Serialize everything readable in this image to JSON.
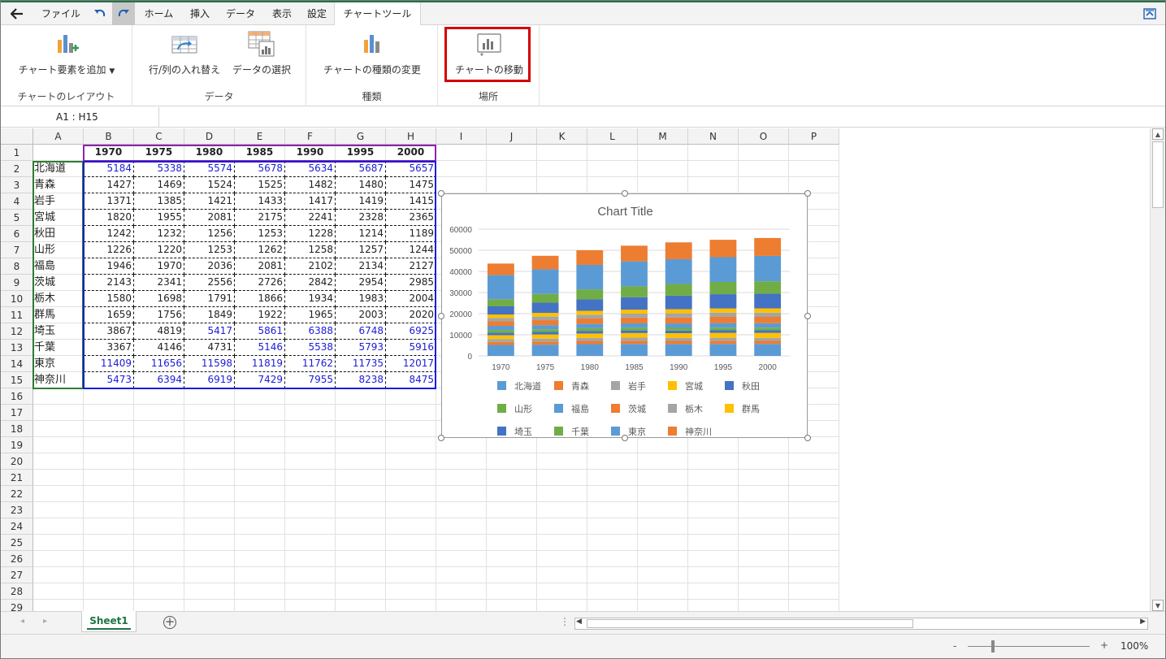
{
  "menubar": {
    "file_label": "ファイル",
    "tabs": [
      "ホーム",
      "挿入",
      "データ",
      "表示",
      "設定",
      "チャートツール"
    ],
    "active_tab": "チャートツール"
  },
  "ribbon": {
    "groups": [
      {
        "label": "チャートのレイアウト",
        "buttons": [
          "チャート要素を追加"
        ]
      },
      {
        "label": "データ",
        "buttons": [
          "行/列の入れ替え",
          "データの選択"
        ]
      },
      {
        "label": "種類",
        "buttons": [
          "チャートの種類の変更"
        ]
      },
      {
        "label": "場所",
        "buttons": [
          "チャートの移動"
        ]
      }
    ],
    "highlighted_button": "チャートの移動",
    "highlight_color": "#d40000"
  },
  "namebox": {
    "value": "A1 : H15"
  },
  "columns": [
    "A",
    "B",
    "C",
    "D",
    "E",
    "F",
    "G",
    "H",
    "I",
    "J",
    "K",
    "L",
    "M",
    "N",
    "O",
    "P"
  ],
  "row_count": 29,
  "table": {
    "years": [
      "1970",
      "1975",
      "1980",
      "1985",
      "1990",
      "1995",
      "2000"
    ],
    "rows": [
      {
        "pref": "北海道",
        "values": [
          "5184",
          "5338",
          "5574",
          "5678",
          "5634",
          "5687",
          "5657"
        ],
        "blue": [
          true,
          true,
          true,
          true,
          true,
          true,
          true
        ]
      },
      {
        "pref": "青森",
        "values": [
          "1427",
          "1469",
          "1524",
          "1525",
          "1482",
          "1480",
          "1475"
        ],
        "blue": [
          false,
          false,
          false,
          false,
          false,
          false,
          false
        ]
      },
      {
        "pref": "岩手",
        "values": [
          "1371",
          "1385",
          "1421",
          "1433",
          "1417",
          "1419",
          "1415"
        ],
        "blue": [
          false,
          false,
          false,
          false,
          false,
          false,
          false
        ]
      },
      {
        "pref": "宮城",
        "values": [
          "1820",
          "1955",
          "2081",
          "2175",
          "2241",
          "2328",
          "2365"
        ],
        "blue": [
          false,
          false,
          false,
          false,
          false,
          false,
          false
        ]
      },
      {
        "pref": "秋田",
        "values": [
          "1242",
          "1232",
          "1256",
          "1253",
          "1228",
          "1214",
          "1189"
        ],
        "blue": [
          false,
          false,
          false,
          false,
          false,
          false,
          false
        ]
      },
      {
        "pref": "山形",
        "values": [
          "1226",
          "1220",
          "1253",
          "1262",
          "1258",
          "1257",
          "1244"
        ],
        "blue": [
          false,
          false,
          false,
          false,
          false,
          false,
          false
        ]
      },
      {
        "pref": "福島",
        "values": [
          "1946",
          "1970",
          "2036",
          "2081",
          "2102",
          "2134",
          "2127"
        ],
        "blue": [
          false,
          false,
          false,
          false,
          false,
          false,
          false
        ]
      },
      {
        "pref": "茨城",
        "values": [
          "2143",
          "2341",
          "2556",
          "2726",
          "2842",
          "2954",
          "2985"
        ],
        "blue": [
          false,
          false,
          false,
          false,
          false,
          false,
          false
        ]
      },
      {
        "pref": "栃木",
        "values": [
          "1580",
          "1698",
          "1791",
          "1866",
          "1934",
          "1983",
          "2004"
        ],
        "blue": [
          false,
          false,
          false,
          false,
          false,
          false,
          false
        ]
      },
      {
        "pref": "群馬",
        "values": [
          "1659",
          "1756",
          "1849",
          "1922",
          "1965",
          "2003",
          "2020"
        ],
        "blue": [
          false,
          false,
          false,
          false,
          false,
          false,
          false
        ]
      },
      {
        "pref": "埼玉",
        "values": [
          "3867",
          "4819",
          "5417",
          "5861",
          "6388",
          "6748",
          "6925"
        ],
        "blue": [
          false,
          false,
          true,
          true,
          true,
          true,
          true
        ]
      },
      {
        "pref": "千葉",
        "values": [
          "3367",
          "4146",
          "4731",
          "5146",
          "5538",
          "5793",
          "5916"
        ],
        "blue": [
          false,
          false,
          false,
          true,
          true,
          true,
          true
        ]
      },
      {
        "pref": "東京",
        "values": [
          "11409",
          "11656",
          "11598",
          "11819",
          "11762",
          "11735",
          "12017"
        ],
        "blue": [
          true,
          true,
          true,
          true,
          true,
          true,
          true
        ]
      },
      {
        "pref": "神奈川",
        "values": [
          "5473",
          "6394",
          "6919",
          "7429",
          "7955",
          "8238",
          "8475"
        ],
        "blue": [
          true,
          true,
          true,
          true,
          true,
          true,
          true
        ]
      }
    ]
  },
  "chart_data": {
    "type": "bar",
    "stacked": true,
    "title": "Chart Title",
    "categories": [
      "1970",
      "1975",
      "1980",
      "1985",
      "1990",
      "1995",
      "2000"
    ],
    "ylim": [
      0,
      60000
    ],
    "yticks": [
      "0",
      "10000",
      "20000",
      "30000",
      "40000",
      "50000",
      "60000"
    ],
    "legend_position": "bottom",
    "series": [
      {
        "name": "北海道",
        "color": "#5b9bd5",
        "values": [
          5184,
          5338,
          5574,
          5678,
          5634,
          5687,
          5657
        ]
      },
      {
        "name": "青森",
        "color": "#ed7d31",
        "values": [
          1427,
          1469,
          1524,
          1525,
          1482,
          1480,
          1475
        ]
      },
      {
        "name": "岩手",
        "color": "#a5a5a5",
        "values": [
          1371,
          1385,
          1421,
          1433,
          1417,
          1419,
          1415
        ]
      },
      {
        "name": "宮城",
        "color": "#ffc000",
        "values": [
          1820,
          1955,
          2081,
          2175,
          2241,
          2328,
          2365
        ]
      },
      {
        "name": "秋田",
        "color": "#4472c4",
        "values": [
          1242,
          1232,
          1256,
          1253,
          1228,
          1214,
          1189
        ]
      },
      {
        "name": "山形",
        "color": "#70ad47",
        "values": [
          1226,
          1220,
          1253,
          1262,
          1258,
          1257,
          1244
        ]
      },
      {
        "name": "福島",
        "color": "#5b9bd5",
        "values": [
          1946,
          1970,
          2036,
          2081,
          2102,
          2134,
          2127
        ]
      },
      {
        "name": "茨城",
        "color": "#ed7d31",
        "values": [
          2143,
          2341,
          2556,
          2726,
          2842,
          2954,
          2985
        ]
      },
      {
        "name": "栃木",
        "color": "#a5a5a5",
        "values": [
          1580,
          1698,
          1791,
          1866,
          1934,
          1983,
          2004
        ]
      },
      {
        "name": "群馬",
        "color": "#ffc000",
        "values": [
          1659,
          1756,
          1849,
          1922,
          1965,
          2003,
          2020
        ]
      },
      {
        "name": "埼玉",
        "color": "#4472c4",
        "values": [
          3867,
          4819,
          5417,
          5861,
          6388,
          6748,
          6925
        ]
      },
      {
        "name": "千葉",
        "color": "#70ad47",
        "values": [
          3367,
          4146,
          4731,
          5146,
          5538,
          5793,
          5916
        ]
      },
      {
        "name": "東京",
        "color": "#5b9bd5",
        "values": [
          11409,
          11656,
          11598,
          11819,
          11762,
          11735,
          12017
        ]
      },
      {
        "name": "神奈川",
        "color": "#ed7d31",
        "values": [
          5473,
          6394,
          6919,
          7429,
          7955,
          8238,
          8475
        ]
      }
    ]
  },
  "sheet": {
    "tab_label": "Sheet1",
    "add_icon": "plus-circle-icon"
  },
  "status": {
    "zoom_minus": "-",
    "zoom_plus": "+",
    "zoom_level": "100%"
  }
}
